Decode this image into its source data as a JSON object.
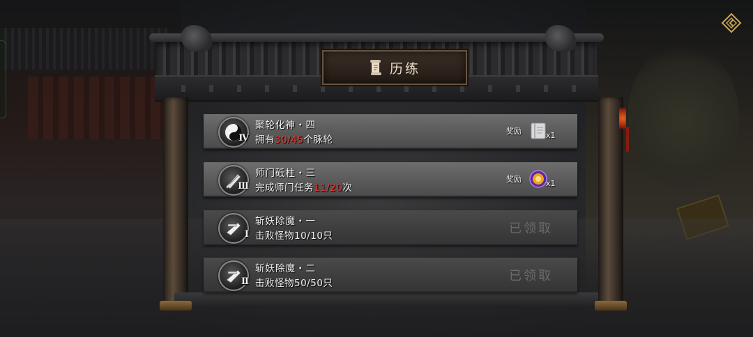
{
  "panel": {
    "title": "历练",
    "title_icon": "scroll-icon"
  },
  "colors": {
    "progress_text": "#e03a32",
    "claimed_text": "#6a6a6a",
    "row_bg": "#5a5a5a",
    "plaque_bg": "#2e241d"
  },
  "quests": [
    {
      "name": "聚轮化神・四",
      "desc_prefix": "拥有",
      "progress": "30/45",
      "desc_suffix": "个脉轮",
      "numeral": "Ⅳ",
      "icon": "yin-yang-icon",
      "reward_label": "奖励",
      "reward_icon": "scroll-book-icon",
      "reward_count": "x1",
      "claimed": false
    },
    {
      "name": "师门砥柱・三",
      "desc_prefix": "完成师门任务",
      "progress": "11/20",
      "desc_suffix": "次",
      "numeral": "Ⅲ",
      "icon": "sword-icon",
      "reward_label": "奖励",
      "reward_icon": "purple-orb-icon",
      "reward_count": "x1",
      "claimed": false
    },
    {
      "name": "斩妖除魔・一",
      "desc_prefix": "击败怪物",
      "progress": "10/10",
      "desc_suffix": "只",
      "numeral": "Ⅰ",
      "icon": "blade-icon",
      "claimed_label": "已领取",
      "claimed": true
    },
    {
      "name": "斩妖除魔・二",
      "desc_prefix": "击败怪物",
      "progress": "50/50",
      "desc_suffix": "只",
      "numeral": "Ⅱ",
      "icon": "blade-icon",
      "claimed_label": "已领取",
      "claimed": true
    }
  ],
  "corner_button_icon": "diamond-back-icon"
}
